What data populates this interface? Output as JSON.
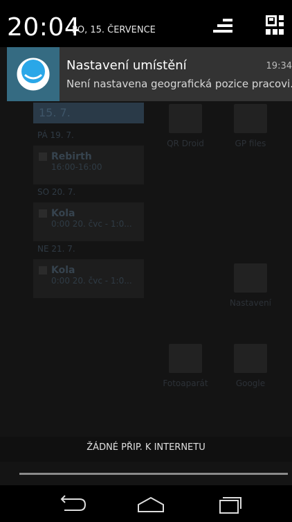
{
  "status_bar": {
    "clock": "20:04",
    "date": "PO, 15. ČERVENCE"
  },
  "notification": {
    "title": "Nastavení umístění",
    "time": "19:34",
    "text": "Není nastavena geografická pozice pracovi."
  },
  "background": {
    "calendar": {
      "header": "15. 7.",
      "days": [
        {
          "label": "PÁ 19. 7.",
          "event_title": "Rebirth",
          "event_time": "16:00-16:00"
        },
        {
          "label": "SO 20. 7.",
          "event_title": "Kola",
          "event_time": "0:00 20. čvc - 1:0..."
        },
        {
          "label": "NE 21. 7.",
          "event_title": "Kola",
          "event_time": "0:00 20. čvc - 1:0..."
        }
      ]
    },
    "apps": [
      "QR Droid",
      "GP files",
      "Nastavení",
      "Fotoaparát",
      "Google"
    ]
  },
  "network_status": "ŽÁDNÉ PŘIP. K INTERNETU",
  "colors": {
    "notification_bg": "#333333",
    "icon_bg": "#356b82"
  },
  "icons": {
    "quick_settings": "quick-settings-icon",
    "grid": "notification-grid-icon",
    "back": "back-icon",
    "home": "home-icon",
    "recents": "recent-apps-icon"
  }
}
